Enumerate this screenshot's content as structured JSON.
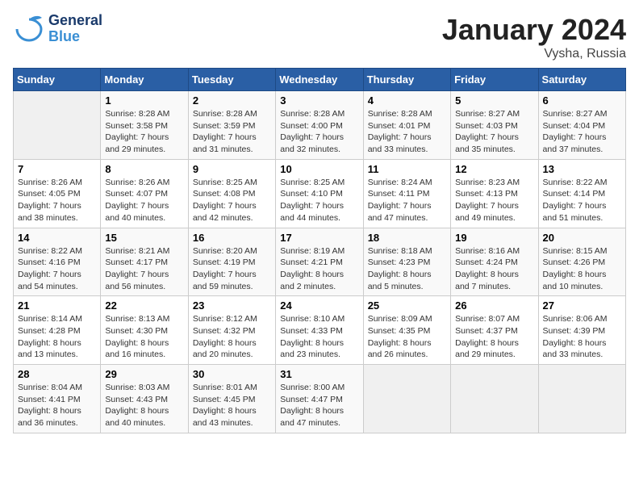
{
  "logo": {
    "general": "General",
    "blue": "Blue"
  },
  "title": "January 2024",
  "subtitle": "Vysha, Russia",
  "days_header": [
    "Sunday",
    "Monday",
    "Tuesday",
    "Wednesday",
    "Thursday",
    "Friday",
    "Saturday"
  ],
  "weeks": [
    [
      {
        "day": "",
        "info": ""
      },
      {
        "day": "1",
        "info": "Sunrise: 8:28 AM\nSunset: 3:58 PM\nDaylight: 7 hours\nand 29 minutes."
      },
      {
        "day": "2",
        "info": "Sunrise: 8:28 AM\nSunset: 3:59 PM\nDaylight: 7 hours\nand 31 minutes."
      },
      {
        "day": "3",
        "info": "Sunrise: 8:28 AM\nSunset: 4:00 PM\nDaylight: 7 hours\nand 32 minutes."
      },
      {
        "day": "4",
        "info": "Sunrise: 8:28 AM\nSunset: 4:01 PM\nDaylight: 7 hours\nand 33 minutes."
      },
      {
        "day": "5",
        "info": "Sunrise: 8:27 AM\nSunset: 4:03 PM\nDaylight: 7 hours\nand 35 minutes."
      },
      {
        "day": "6",
        "info": "Sunrise: 8:27 AM\nSunset: 4:04 PM\nDaylight: 7 hours\nand 37 minutes."
      }
    ],
    [
      {
        "day": "7",
        "info": "Sunrise: 8:26 AM\nSunset: 4:05 PM\nDaylight: 7 hours\nand 38 minutes."
      },
      {
        "day": "8",
        "info": "Sunrise: 8:26 AM\nSunset: 4:07 PM\nDaylight: 7 hours\nand 40 minutes."
      },
      {
        "day": "9",
        "info": "Sunrise: 8:25 AM\nSunset: 4:08 PM\nDaylight: 7 hours\nand 42 minutes."
      },
      {
        "day": "10",
        "info": "Sunrise: 8:25 AM\nSunset: 4:10 PM\nDaylight: 7 hours\nand 44 minutes."
      },
      {
        "day": "11",
        "info": "Sunrise: 8:24 AM\nSunset: 4:11 PM\nDaylight: 7 hours\nand 47 minutes."
      },
      {
        "day": "12",
        "info": "Sunrise: 8:23 AM\nSunset: 4:13 PM\nDaylight: 7 hours\nand 49 minutes."
      },
      {
        "day": "13",
        "info": "Sunrise: 8:22 AM\nSunset: 4:14 PM\nDaylight: 7 hours\nand 51 minutes."
      }
    ],
    [
      {
        "day": "14",
        "info": "Sunrise: 8:22 AM\nSunset: 4:16 PM\nDaylight: 7 hours\nand 54 minutes."
      },
      {
        "day": "15",
        "info": "Sunrise: 8:21 AM\nSunset: 4:17 PM\nDaylight: 7 hours\nand 56 minutes."
      },
      {
        "day": "16",
        "info": "Sunrise: 8:20 AM\nSunset: 4:19 PM\nDaylight: 7 hours\nand 59 minutes."
      },
      {
        "day": "17",
        "info": "Sunrise: 8:19 AM\nSunset: 4:21 PM\nDaylight: 8 hours\nand 2 minutes."
      },
      {
        "day": "18",
        "info": "Sunrise: 8:18 AM\nSunset: 4:23 PM\nDaylight: 8 hours\nand 5 minutes."
      },
      {
        "day": "19",
        "info": "Sunrise: 8:16 AM\nSunset: 4:24 PM\nDaylight: 8 hours\nand 7 minutes."
      },
      {
        "day": "20",
        "info": "Sunrise: 8:15 AM\nSunset: 4:26 PM\nDaylight: 8 hours\nand 10 minutes."
      }
    ],
    [
      {
        "day": "21",
        "info": "Sunrise: 8:14 AM\nSunset: 4:28 PM\nDaylight: 8 hours\nand 13 minutes."
      },
      {
        "day": "22",
        "info": "Sunrise: 8:13 AM\nSunset: 4:30 PM\nDaylight: 8 hours\nand 16 minutes."
      },
      {
        "day": "23",
        "info": "Sunrise: 8:12 AM\nSunset: 4:32 PM\nDaylight: 8 hours\nand 20 minutes."
      },
      {
        "day": "24",
        "info": "Sunrise: 8:10 AM\nSunset: 4:33 PM\nDaylight: 8 hours\nand 23 minutes."
      },
      {
        "day": "25",
        "info": "Sunrise: 8:09 AM\nSunset: 4:35 PM\nDaylight: 8 hours\nand 26 minutes."
      },
      {
        "day": "26",
        "info": "Sunrise: 8:07 AM\nSunset: 4:37 PM\nDaylight: 8 hours\nand 29 minutes."
      },
      {
        "day": "27",
        "info": "Sunrise: 8:06 AM\nSunset: 4:39 PM\nDaylight: 8 hours\nand 33 minutes."
      }
    ],
    [
      {
        "day": "28",
        "info": "Sunrise: 8:04 AM\nSunset: 4:41 PM\nDaylight: 8 hours\nand 36 minutes."
      },
      {
        "day": "29",
        "info": "Sunrise: 8:03 AM\nSunset: 4:43 PM\nDaylight: 8 hours\nand 40 minutes."
      },
      {
        "day": "30",
        "info": "Sunrise: 8:01 AM\nSunset: 4:45 PM\nDaylight: 8 hours\nand 43 minutes."
      },
      {
        "day": "31",
        "info": "Sunrise: 8:00 AM\nSunset: 4:47 PM\nDaylight: 8 hours\nand 47 minutes."
      },
      {
        "day": "",
        "info": ""
      },
      {
        "day": "",
        "info": ""
      },
      {
        "day": "",
        "info": ""
      }
    ]
  ]
}
